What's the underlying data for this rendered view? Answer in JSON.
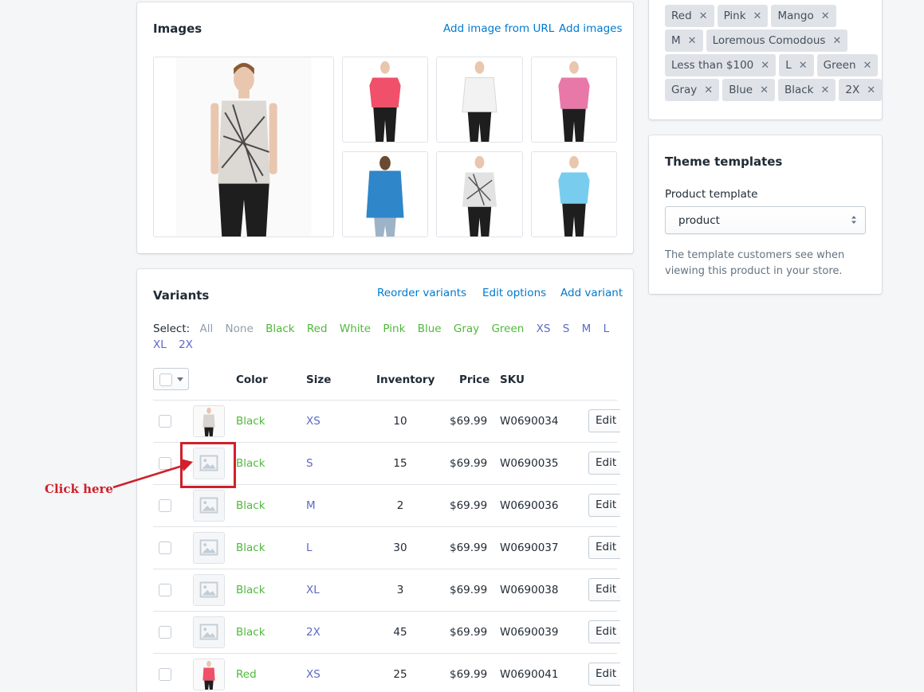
{
  "tags": {
    "rows": [
      [
        "",
        "",
        "",
        ""
      ],
      [
        "Red",
        "Pink",
        "Mango"
      ],
      [
        "M",
        "Loremous Comodous"
      ],
      [
        "Less than $100",
        "L",
        "Green"
      ],
      [
        "Gray",
        "Blue",
        "Black",
        "2X"
      ]
    ]
  },
  "theme": {
    "title": "Theme templates",
    "field_label": "Product template",
    "selected": "product",
    "help": "The template customers see when viewing this product in your store."
  },
  "images": {
    "title": "Images",
    "add_from_url": "Add image from URL",
    "add_images": "Add images",
    "thumbnails": [
      {
        "icon": "model-sleeveless-print-blouse",
        "shirt": "#d8d4d0"
      },
      {
        "icon": "model-red-top",
        "shirt": "#f0506a"
      },
      {
        "icon": "model-white-top",
        "shirt": "#f2f2f2"
      },
      {
        "icon": "model-pink-top",
        "shirt": "#e878a8"
      },
      {
        "icon": "model-blue-hoodie-back",
        "shirt": "#2f86c8"
      },
      {
        "icon": "model-print-blouse",
        "shirt": "#e2e2e2"
      },
      {
        "icon": "model-light-blue-top",
        "shirt": "#78cdee"
      }
    ]
  },
  "variants": {
    "title": "Variants",
    "reorder": "Reorder variants",
    "edit_options": "Edit options",
    "add_variant": "Add variant",
    "select_label": "Select:",
    "select_options": [
      {
        "label": "All",
        "tone": "gray"
      },
      {
        "label": "None",
        "tone": "gray"
      },
      {
        "label": "Black",
        "tone": "green"
      },
      {
        "label": "Red",
        "tone": "green"
      },
      {
        "label": "White",
        "tone": "green"
      },
      {
        "label": "Pink",
        "tone": "green"
      },
      {
        "label": "Blue",
        "tone": "green"
      },
      {
        "label": "Gray",
        "tone": "green"
      },
      {
        "label": "Green",
        "tone": "green"
      },
      {
        "label": "XS",
        "tone": "purple"
      },
      {
        "label": "S",
        "tone": "purple"
      },
      {
        "label": "M",
        "tone": "purple"
      },
      {
        "label": "L",
        "tone": "purple"
      },
      {
        "label": "XL",
        "tone": "purple"
      },
      {
        "label": "2X",
        "tone": "purple"
      }
    ],
    "columns": {
      "color": "Color",
      "size": "Size",
      "inventory": "Inventory",
      "price": "Price",
      "sku": "SKU"
    },
    "edit_label": "Edit",
    "rows": [
      {
        "thumb": "variant-photo-print-blouse",
        "color": "Black",
        "size": "XS",
        "inventory": "10",
        "price": "$69.99",
        "sku": "W0690034"
      },
      {
        "thumb": "image-placeholder-icon",
        "color": "Black",
        "size": "S",
        "inventory": "15",
        "price": "$69.99",
        "sku": "W0690035"
      },
      {
        "thumb": "image-placeholder-icon",
        "color": "Black",
        "size": "M",
        "inventory": "2",
        "price": "$69.99",
        "sku": "W0690036"
      },
      {
        "thumb": "image-placeholder-icon",
        "color": "Black",
        "size": "L",
        "inventory": "30",
        "price": "$69.99",
        "sku": "W0690037"
      },
      {
        "thumb": "image-placeholder-icon",
        "color": "Black",
        "size": "XL",
        "inventory": "3",
        "price": "$69.99",
        "sku": "W0690038"
      },
      {
        "thumb": "image-placeholder-icon",
        "color": "Black",
        "size": "2X",
        "inventory": "45",
        "price": "$69.99",
        "sku": "W0690039"
      },
      {
        "thumb": "variant-photo-red-top",
        "color": "Red",
        "size": "XS",
        "inventory": "25",
        "price": "$69.99",
        "sku": "W0690041"
      }
    ]
  },
  "annotation": {
    "text": "Click here",
    "color": "#d0202b"
  }
}
